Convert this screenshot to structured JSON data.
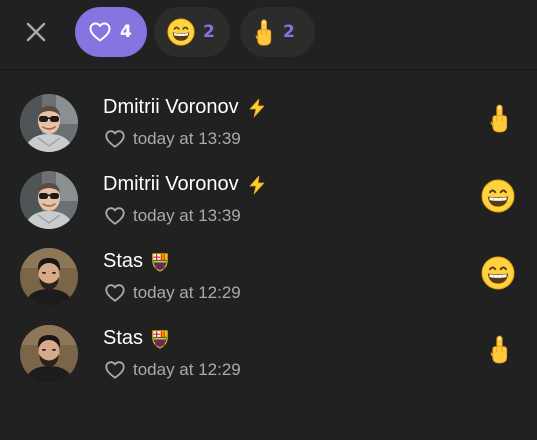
{
  "tabs": [
    {
      "icon": "heart-icon",
      "count": "4",
      "active": true
    },
    {
      "icon": "grin-emoji-icon",
      "count": "2",
      "active": false
    },
    {
      "icon": "middle-finger-emoji-icon",
      "count": "2",
      "active": false
    }
  ],
  "reactions": [
    {
      "name": "Dmitrii Voronov",
      "badge": "lightning-emoji-icon",
      "time": "today at 13:39",
      "reaction": "middle-finger-emoji-icon"
    },
    {
      "name": "Dmitrii Voronov",
      "badge": "lightning-emoji-icon",
      "time": "today at 13:39",
      "reaction": "grin-emoji-icon"
    },
    {
      "name": "Stas",
      "badge": "fc-barcelona-crest-icon",
      "time": "today at 12:29",
      "reaction": "grin-emoji-icon"
    },
    {
      "name": "Stas",
      "badge": "fc-barcelona-crest-icon",
      "time": "today at 12:29",
      "reaction": "middle-finger-emoji-icon"
    }
  ],
  "colors": {
    "accent": "#8774e1",
    "background": "#212121",
    "secondary_text": "#aaaaaa"
  }
}
